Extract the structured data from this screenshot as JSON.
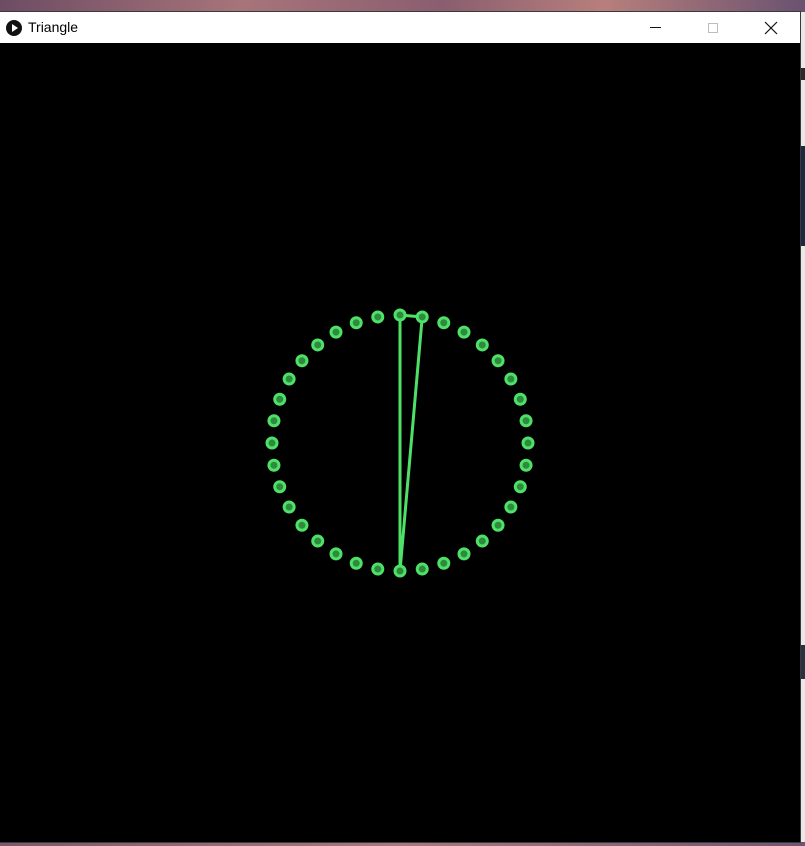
{
  "window": {
    "title": "Triangle",
    "icon": "play-circle-icon",
    "controls": [
      "minimize-icon",
      "maximize-icon",
      "close-icon"
    ]
  },
  "sketch": {
    "background": "#000000",
    "accent_color": "#4fe068",
    "point_count": 36,
    "triangle_vertex_indices": [
      0,
      1,
      18
    ]
  }
}
